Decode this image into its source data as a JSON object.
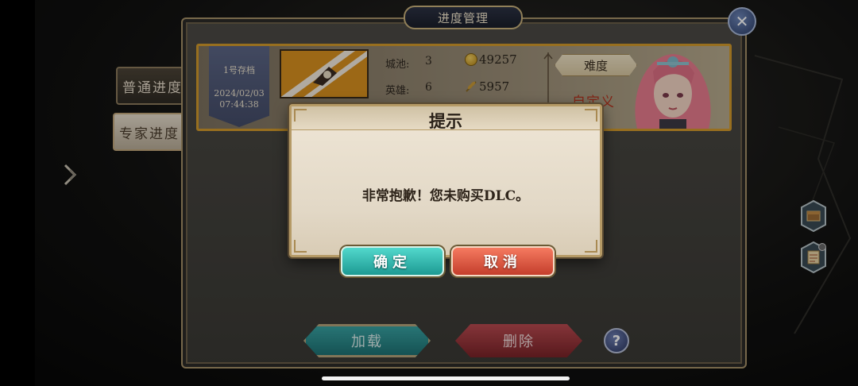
{
  "window": {
    "title": "进度管理"
  },
  "tabs": [
    {
      "label": "普通进度"
    },
    {
      "label": "专家进度"
    }
  ],
  "slot": {
    "label": "1号存档",
    "date": "2024/02/03",
    "time": "07:44:38",
    "cities_label": "城池:",
    "cities_value": "3",
    "heroes_label": "英雄:",
    "heroes_value": "6",
    "gold": "49257",
    "food": "5957",
    "difficulty_label": "难度",
    "difficulty_value": "自定义"
  },
  "dialog": {
    "title": "提示",
    "message": "非常抱歉！您未购买DLC。",
    "ok_label": "确定",
    "cancel_label": "取消"
  },
  "actions": {
    "load_label": "加载",
    "delete_label": "删除",
    "help_label": "?",
    "close_label": "✕"
  },
  "colors": {
    "slot_border": "#d39a2c",
    "ok_button": "#2ab3aa",
    "cancel_button": "#e05a44",
    "difficulty_text": "#b5341f"
  },
  "icons": [
    "close-icon",
    "coin-icon",
    "wheat-icon",
    "expand-arrow-icon",
    "chest-icon",
    "scroll-icon",
    "help-icon"
  ]
}
